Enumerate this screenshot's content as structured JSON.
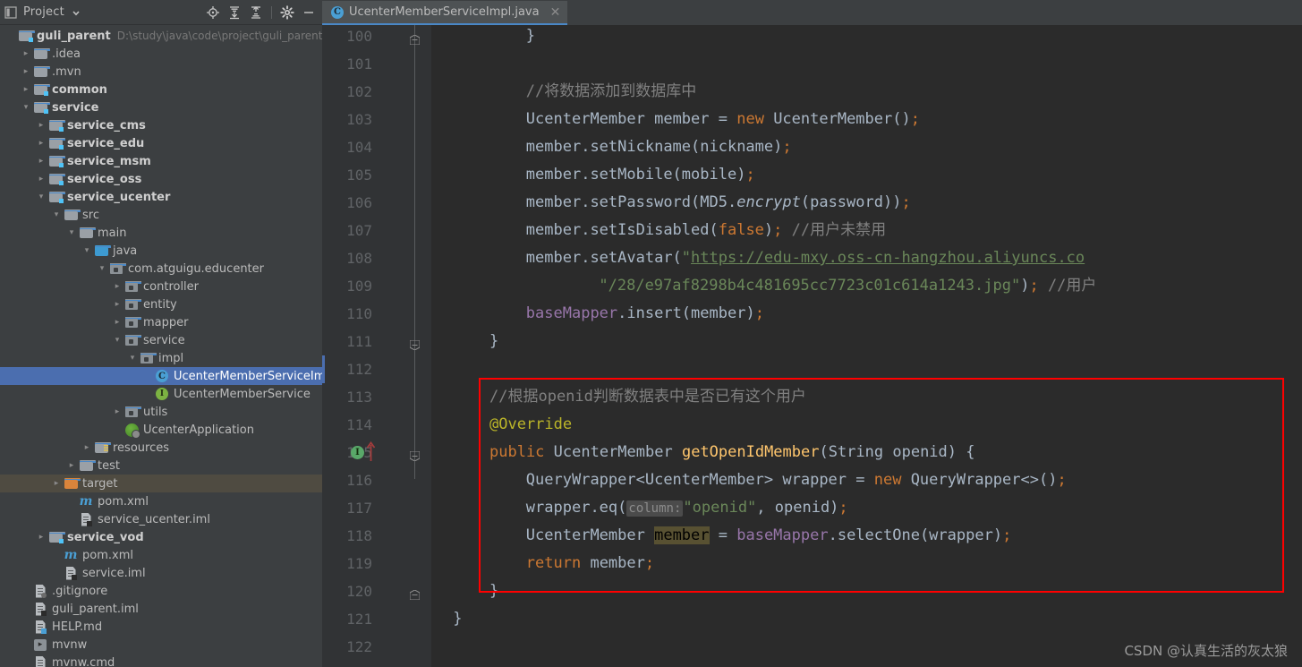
{
  "project_panel": {
    "title": "Project",
    "icons": [
      "project-window-icon",
      "chevron-down-icon",
      "locate-icon",
      "expand-all-icon",
      "collapse-all-icon",
      "settings-gear-icon",
      "minimize-icon"
    ],
    "root": {
      "label": "guli_parent",
      "path": "D:\\study\\java\\code\\project\\guli_parent"
    },
    "tree": [
      {
        "label": "guli_parent",
        "sub": "D:\\study\\java\\code\\project\\guli_parent",
        "depth": 0,
        "arrow": "none",
        "icon": "module-folder-icon",
        "bold": true,
        "state": "none"
      },
      {
        "label": ".idea",
        "sub": "",
        "depth": 1,
        "arrow": "right",
        "icon": "folder-icon",
        "bold": false,
        "state": "none"
      },
      {
        "label": ".mvn",
        "sub": "",
        "depth": 1,
        "arrow": "right",
        "icon": "folder-icon",
        "bold": false,
        "state": "none"
      },
      {
        "label": "common",
        "sub": "",
        "depth": 1,
        "arrow": "right",
        "icon": "module-folder-icon",
        "bold": true,
        "state": "none"
      },
      {
        "label": "service",
        "sub": "",
        "depth": 1,
        "arrow": "down",
        "icon": "module-folder-icon",
        "bold": true,
        "state": "none"
      },
      {
        "label": "service_cms",
        "sub": "",
        "depth": 2,
        "arrow": "right",
        "icon": "module-folder-icon",
        "bold": true,
        "state": "none"
      },
      {
        "label": "service_edu",
        "sub": "",
        "depth": 2,
        "arrow": "right",
        "icon": "module-folder-icon",
        "bold": true,
        "state": "none"
      },
      {
        "label": "service_msm",
        "sub": "",
        "depth": 2,
        "arrow": "right",
        "icon": "module-folder-icon",
        "bold": true,
        "state": "none"
      },
      {
        "label": "service_oss",
        "sub": "",
        "depth": 2,
        "arrow": "right",
        "icon": "module-folder-icon",
        "bold": true,
        "state": "none"
      },
      {
        "label": "service_ucenter",
        "sub": "",
        "depth": 2,
        "arrow": "down",
        "icon": "module-folder-icon",
        "bold": true,
        "state": "none"
      },
      {
        "label": "src",
        "sub": "",
        "depth": 3,
        "arrow": "down",
        "icon": "folder-icon",
        "bold": false,
        "state": "none"
      },
      {
        "label": "main",
        "sub": "",
        "depth": 4,
        "arrow": "down",
        "icon": "folder-icon",
        "bold": false,
        "state": "none"
      },
      {
        "label": "java",
        "sub": "",
        "depth": 5,
        "arrow": "down",
        "icon": "source-folder-icon",
        "bold": false,
        "state": "none"
      },
      {
        "label": "com.atguigu.educenter",
        "sub": "",
        "depth": 6,
        "arrow": "down",
        "icon": "package-icon",
        "bold": false,
        "state": "none"
      },
      {
        "label": "controller",
        "sub": "",
        "depth": 7,
        "arrow": "right",
        "icon": "package-icon",
        "bold": false,
        "state": "none"
      },
      {
        "label": "entity",
        "sub": "",
        "depth": 7,
        "arrow": "right",
        "icon": "package-icon",
        "bold": false,
        "state": "none"
      },
      {
        "label": "mapper",
        "sub": "",
        "depth": 7,
        "arrow": "right",
        "icon": "package-icon",
        "bold": false,
        "state": "none"
      },
      {
        "label": "service",
        "sub": "",
        "depth": 7,
        "arrow": "down",
        "icon": "package-icon",
        "bold": false,
        "state": "none"
      },
      {
        "label": "impl",
        "sub": "",
        "depth": 8,
        "arrow": "down",
        "icon": "package-icon",
        "bold": false,
        "state": "none"
      },
      {
        "label": "UcenterMemberServiceImpl",
        "sub": "",
        "depth": 9,
        "arrow": "none",
        "icon": "java-class-icon",
        "bold": false,
        "state": "selected"
      },
      {
        "label": "UcenterMemberService",
        "sub": "",
        "depth": 9,
        "arrow": "none",
        "icon": "java-interface-icon",
        "bold": false,
        "state": "none"
      },
      {
        "label": "utils",
        "sub": "",
        "depth": 7,
        "arrow": "right",
        "icon": "package-icon",
        "bold": false,
        "state": "none"
      },
      {
        "label": "UcenterApplication",
        "sub": "",
        "depth": 7,
        "arrow": "none",
        "icon": "spring-boot-icon",
        "bold": false,
        "state": "none"
      },
      {
        "label": "resources",
        "sub": "",
        "depth": 5,
        "arrow": "right",
        "icon": "resources-folder-icon",
        "bold": false,
        "state": "none"
      },
      {
        "label": "test",
        "sub": "",
        "depth": 4,
        "arrow": "right",
        "icon": "folder-icon",
        "bold": false,
        "state": "none"
      },
      {
        "label": "target",
        "sub": "",
        "depth": 3,
        "arrow": "right",
        "icon": "excluded-folder-icon",
        "bold": false,
        "state": "highlight"
      },
      {
        "label": "pom.xml",
        "sub": "",
        "depth": 4,
        "arrow": "none",
        "icon": "maven-icon",
        "bold": false,
        "state": "none"
      },
      {
        "label": "service_ucenter.iml",
        "sub": "",
        "depth": 4,
        "arrow": "none",
        "icon": "iml-file-icon",
        "bold": false,
        "state": "none"
      },
      {
        "label": "service_vod",
        "sub": "",
        "depth": 2,
        "arrow": "right",
        "icon": "module-folder-icon",
        "bold": true,
        "state": "none"
      },
      {
        "label": "pom.xml",
        "sub": "",
        "depth": 3,
        "arrow": "none",
        "icon": "maven-icon",
        "bold": false,
        "state": "none"
      },
      {
        "label": "service.iml",
        "sub": "",
        "depth": 3,
        "arrow": "none",
        "icon": "iml-file-icon",
        "bold": false,
        "state": "none"
      },
      {
        "label": ".gitignore",
        "sub": "",
        "depth": 1,
        "arrow": "none",
        "icon": "gitignore-icon",
        "bold": false,
        "state": "none"
      },
      {
        "label": "guli_parent.iml",
        "sub": "",
        "depth": 1,
        "arrow": "none",
        "icon": "iml-file-icon",
        "bold": false,
        "state": "none"
      },
      {
        "label": "HELP.md",
        "sub": "",
        "depth": 1,
        "arrow": "none",
        "icon": "markdown-icon",
        "bold": false,
        "state": "none"
      },
      {
        "label": "mvnw",
        "sub": "",
        "depth": 1,
        "arrow": "none",
        "icon": "shell-script-icon",
        "bold": false,
        "state": "none"
      },
      {
        "label": "mvnw.cmd",
        "sub": "",
        "depth": 1,
        "arrow": "none",
        "icon": "cmd-file-icon",
        "bold": false,
        "state": "none"
      }
    ]
  },
  "editor": {
    "tab": {
      "label": "UcenterMemberServiceImpl.java",
      "icon": "java-class-icon",
      "close_icon": "close-icon"
    },
    "first_line_number": 100,
    "last_line_number": 122,
    "line_numbers": [
      "100",
      "101",
      "102",
      "103",
      "104",
      "105",
      "106",
      "107",
      "108",
      "109",
      "110",
      "111",
      "112",
      "113",
      "114",
      "115",
      "116",
      "117",
      "118",
      "119",
      "120",
      "121",
      "122"
    ],
    "gutter_markers": [
      {
        "line": "115",
        "icon": "implementing-method-icon",
        "label": "I"
      },
      {
        "line": "115",
        "icon": "override-arrow-icon"
      }
    ],
    "code_lines": [
      {
        "num": "100",
        "indent": 4,
        "tokens": [
          {
            "t": "}",
            "c": "def"
          }
        ]
      },
      {
        "num": "101",
        "indent": 0,
        "tokens": []
      },
      {
        "num": "102",
        "indent": 4,
        "tokens": [
          {
            "t": "//将数据添加到数据库中",
            "c": "cmt"
          }
        ]
      },
      {
        "num": "103",
        "indent": 4,
        "tokens": [
          {
            "t": "UcenterMember",
            "c": "type"
          },
          {
            "t": " member ",
            "c": "def"
          },
          {
            "t": "= ",
            "c": "def"
          },
          {
            "t": "new ",
            "c": "kw"
          },
          {
            "t": "UcenterMember()",
            "c": "def"
          },
          {
            "t": ";",
            "c": "semi"
          }
        ]
      },
      {
        "num": "104",
        "indent": 4,
        "tokens": [
          {
            "t": "member.setNickname(nickname)",
            "c": "def"
          },
          {
            "t": ";",
            "c": "semi"
          }
        ]
      },
      {
        "num": "105",
        "indent": 4,
        "tokens": [
          {
            "t": "member.setMobile(mobile)",
            "c": "def"
          },
          {
            "t": ";",
            "c": "semi"
          }
        ]
      },
      {
        "num": "106",
        "indent": 4,
        "tokens": [
          {
            "t": "member.setPassword(MD5.",
            "c": "def"
          },
          {
            "t": "encrypt",
            "c": "static"
          },
          {
            "t": "(password))",
            "c": "def"
          },
          {
            "t": ";",
            "c": "semi"
          }
        ]
      },
      {
        "num": "107",
        "indent": 4,
        "tokens": [
          {
            "t": "member.setIsDisabled(",
            "c": "def"
          },
          {
            "t": "false",
            "c": "kw"
          },
          {
            "t": ")",
            "c": "def"
          },
          {
            "t": ";",
            "c": "semi"
          },
          {
            "t": " //用户未禁用",
            "c": "cmt"
          }
        ]
      },
      {
        "num": "108",
        "indent": 4,
        "tokens": [
          {
            "t": "member.setAvatar(",
            "c": "def"
          },
          {
            "t": "\"",
            "c": "str"
          },
          {
            "t": "https://edu-mxy.oss-cn-hangzhou.aliyuncs.co",
            "c": "link"
          }
        ]
      },
      {
        "num": "109",
        "indent": 12,
        "tokens": [
          {
            "t": "\"/28/e97af8298b4c481695cc7723c01c614a1243.jpg\"",
            "c": "str"
          },
          {
            "t": ")",
            "c": "def"
          },
          {
            "t": ";",
            "c": "semi"
          },
          {
            "t": " //用户",
            "c": "cmt"
          }
        ]
      },
      {
        "num": "110",
        "indent": 4,
        "tokens": [
          {
            "t": "baseMapper",
            "c": "field"
          },
          {
            "t": ".insert(member)",
            "c": "def"
          },
          {
            "t": ";",
            "c": "semi"
          }
        ]
      },
      {
        "num": "111",
        "indent": 0,
        "tokens": [
          {
            "t": "}",
            "c": "def"
          }
        ]
      },
      {
        "num": "112",
        "indent": 0,
        "tokens": []
      },
      {
        "num": "113",
        "indent": 0,
        "tokens": [
          {
            "t": "//根据openid判断数据表中是否已有这个用户",
            "c": "cmt"
          }
        ]
      },
      {
        "num": "114",
        "indent": 0,
        "tokens": [
          {
            "t": "@Override",
            "c": "ann"
          }
        ]
      },
      {
        "num": "115",
        "indent": 0,
        "tokens": [
          {
            "t": "public ",
            "c": "kw"
          },
          {
            "t": "UcenterMember ",
            "c": "type"
          },
          {
            "t": "getOpenIdMember",
            "c": "mth"
          },
          {
            "t": "(String openid) {",
            "c": "def"
          }
        ]
      },
      {
        "num": "116",
        "indent": 4,
        "tokens": [
          {
            "t": "QueryWrapper<UcenterMember> wrapper = ",
            "c": "def"
          },
          {
            "t": "new ",
            "c": "kw"
          },
          {
            "t": "QueryWrapper<>()",
            "c": "def"
          },
          {
            "t": ";",
            "c": "semi"
          }
        ]
      },
      {
        "num": "117",
        "indent": 4,
        "tokens": [
          {
            "t": "wrapper.eq(",
            "c": "def"
          },
          {
            "t": "column:",
            "c": "hint"
          },
          {
            "t": "\"openid\"",
            "c": "str"
          },
          {
            "t": ", openid)",
            "c": "def"
          },
          {
            "t": ";",
            "c": "semi"
          }
        ]
      },
      {
        "num": "118",
        "indent": 4,
        "tokens": [
          {
            "t": "UcenterMember ",
            "c": "type"
          },
          {
            "t": "member",
            "c": "identhl"
          },
          {
            "t": " = ",
            "c": "def"
          },
          {
            "t": "baseMapper",
            "c": "field"
          },
          {
            "t": ".selectOne(wrapper)",
            "c": "def"
          },
          {
            "t": ";",
            "c": "semi"
          }
        ]
      },
      {
        "num": "119",
        "indent": 4,
        "tokens": [
          {
            "t": "return ",
            "c": "kw"
          },
          {
            "t": "member",
            "c": "def"
          },
          {
            "t": ";",
            "c": "semi"
          }
        ]
      },
      {
        "num": "120",
        "indent": 0,
        "tokens": [
          {
            "t": "}",
            "c": "def"
          }
        ]
      },
      {
        "num": "121",
        "indent": -4,
        "tokens": [
          {
            "t": "}",
            "c": "def"
          }
        ]
      },
      {
        "num": "122",
        "indent": 0,
        "tokens": []
      }
    ],
    "annotation": {
      "type": "red-rectangle",
      "covers_lines": [
        "113",
        "114",
        "115",
        "116",
        "117",
        "118",
        "119",
        "120"
      ],
      "color": "#ff0000"
    }
  },
  "watermark": {
    "text": "CSDN @认真生活的灰太狼"
  },
  "colors": {
    "panel_bg": "#3c3f41",
    "editor_bg": "#2b2b2b",
    "gutter_bg": "#313335",
    "selection_blue": "#4b6eaf",
    "tab_active_underline": "#4a88c7",
    "annotation_red": "#ff0000",
    "target_highlight": "#4f4b41",
    "text_default": "#a9b7c6",
    "keyword_orange": "#cc7832",
    "string_green": "#6a8759",
    "method_yellow": "#ffc66d",
    "field_purple": "#9876aa",
    "annotation_yellow": "#bbb529",
    "comment_gray": "#808080"
  }
}
